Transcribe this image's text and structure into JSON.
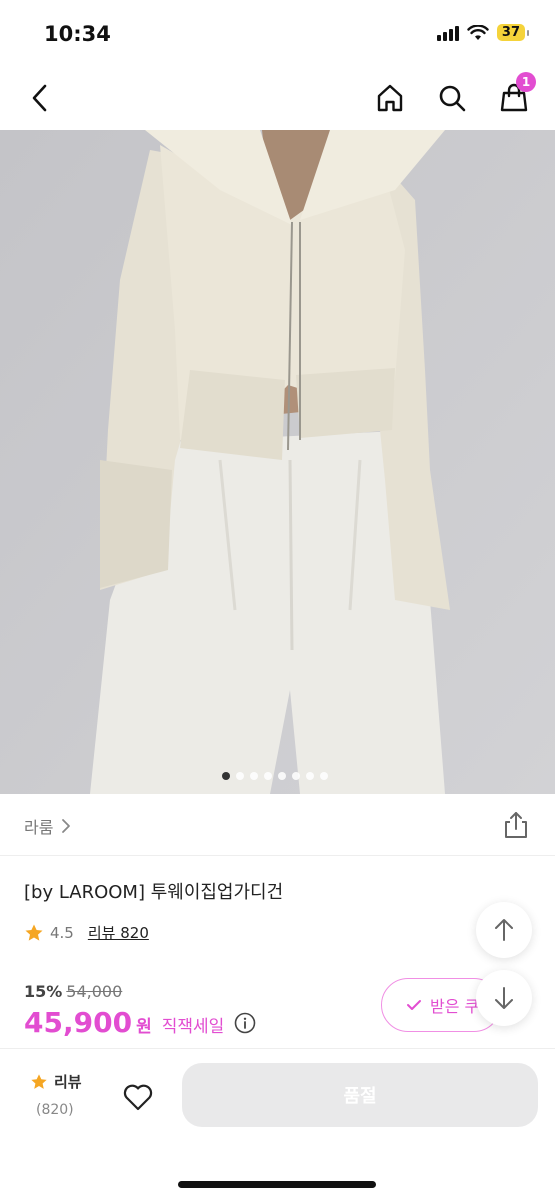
{
  "status_bar": {
    "time": "10:34",
    "battery": "37"
  },
  "nav": {
    "cart_count": "1"
  },
  "gallery": {
    "dot_count": 8,
    "active_index": 0
  },
  "brand": {
    "name": "라룸"
  },
  "product": {
    "title": "[by LAROOM] 투웨이집업가디건",
    "rating": "4.5",
    "review_link": "리뷰 820",
    "discount": "15%",
    "original_price": "54,000",
    "price": "45,900",
    "currency": "원",
    "sale_label": "직잭세일"
  },
  "coupon": {
    "label": "받은 쿠"
  },
  "bottom": {
    "review_label": "리뷰",
    "review_count": "(820)",
    "soldout_label": "품절"
  },
  "colors": {
    "accent": "#e24dd1",
    "star": "#f5a623"
  }
}
